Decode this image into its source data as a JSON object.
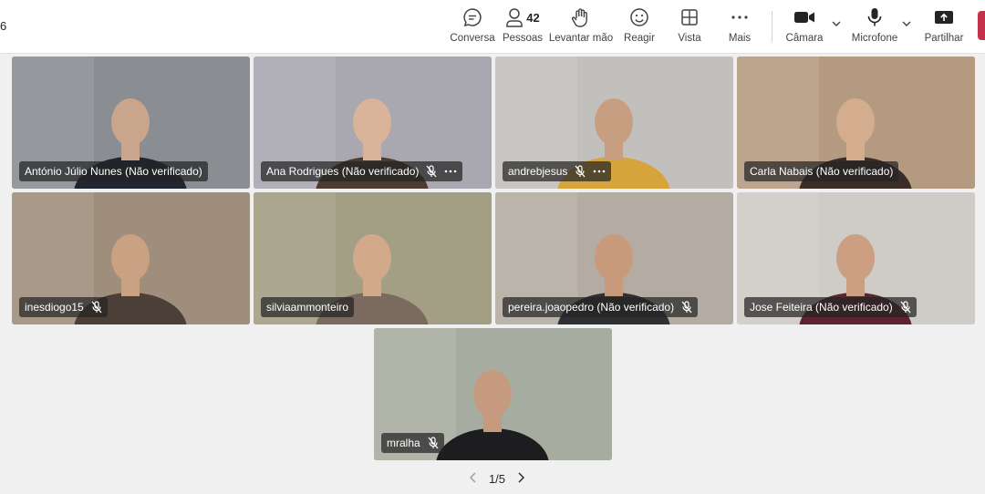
{
  "meeting": {
    "timer_fragment": "6"
  },
  "toolbar": {
    "chat": "Conversa",
    "people": "Pessoas",
    "people_count": "42",
    "raise_hand": "Levantar mão",
    "react": "Reagir",
    "view": "Vista",
    "more": "Mais",
    "camera": "Câmara",
    "microphone": "Microfone",
    "share": "Partilhar"
  },
  "participants": [
    {
      "name": "António Júlio Nunes (Não verificado)",
      "muted": false,
      "bg": "#8a8d92"
    },
    {
      "name": "Ana Rodrigues (Não verificado)",
      "muted": true,
      "bg": "#a9a8b1"
    },
    {
      "name": "andrebjesus",
      "muted": true,
      "bg": "#c2c0bd"
    },
    {
      "name": "Carla Nabais (Não verificado)",
      "muted": false,
      "bg": "#b59a82"
    },
    {
      "name": "inesdiogo15",
      "muted": true,
      "bg": "#a08e7c"
    },
    {
      "name": "silviaammonteiro",
      "muted": false,
      "bg": "#a39f84"
    },
    {
      "name": "pereira.joaopedro (Não verificado)",
      "muted": true,
      "bg": "#b4aca2"
    },
    {
      "name": "Jose Feiteira (Não verificado)",
      "muted": true,
      "bg": "#cfcbc6"
    },
    {
      "name": "mralha",
      "muted": true,
      "bg": "#a7aca0"
    }
  ],
  "pagination": {
    "label": "1/5"
  }
}
